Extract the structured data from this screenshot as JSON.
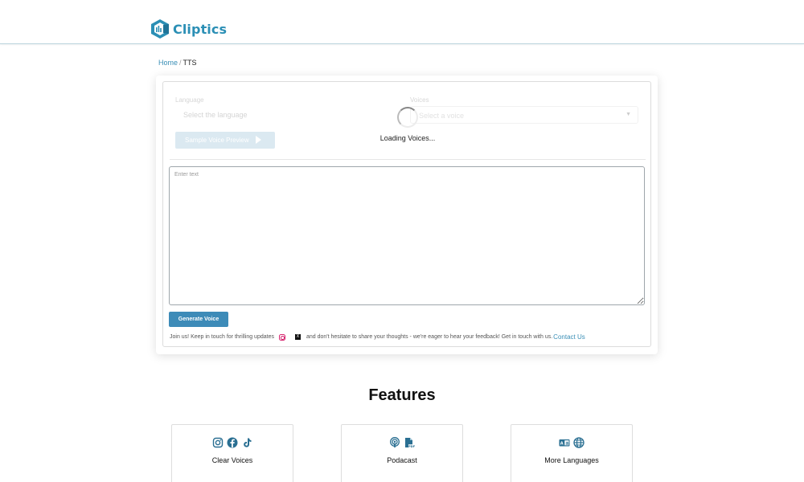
{
  "header": {
    "brand_name": "Cliptics",
    "logo_icon": "cliptics-logo-icon",
    "brand_color": "#2b8fb5"
  },
  "breadcrumb": {
    "home": "Home",
    "separator": "/",
    "current": "TTS"
  },
  "tts_form": {
    "language_label": "Language",
    "language_placeholder": "Select the language",
    "voices_label": "Voices",
    "voices_placeholder": "Select a voice",
    "sample_button_label": "Sample Voice Preview",
    "loading_text": "Loading Voices...",
    "text_placeholder": "Enter text",
    "text_value": "",
    "generate_button_label": "Generate Voice",
    "join_text_1": "Join us! Keep in touch for thrilling updates",
    "join_text_2": "and don't hesitate to share your thoughts - we're eager to hear your feedback! Get in touch with us.",
    "contact_link": "Contact Us",
    "social_icons": [
      "instagram-icon",
      "x-icon"
    ],
    "accent_color": "#3d8bb8"
  },
  "features": {
    "title": "Features",
    "items": [
      {
        "label": "Clear Voices",
        "icons": [
          "instagram-icon",
          "facebook-icon",
          "tiktok-icon"
        ]
      },
      {
        "label": "Podacast",
        "icons": [
          "podcast-icon",
          "pdf-file-icon"
        ]
      },
      {
        "label": "More Languages",
        "icons": [
          "language-card-icon",
          "globe-icon"
        ]
      }
    ]
  }
}
